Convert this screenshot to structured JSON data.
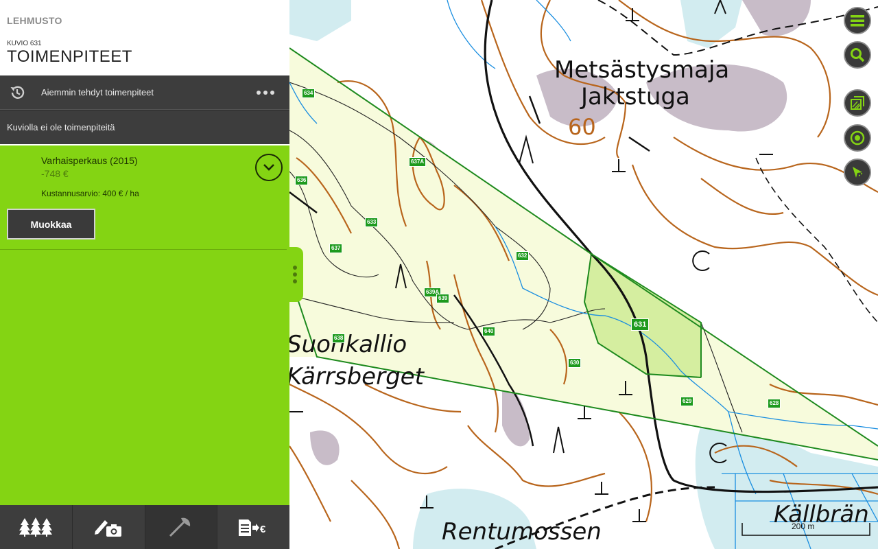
{
  "header": {
    "app_title": "LEHMUSTO",
    "subtitle": "KUVIO 631",
    "title": "TOIMENPITEET"
  },
  "history": {
    "label": "Aiemmin tehdyt toimenpiteet",
    "icon": "history-icon"
  },
  "empty_text": "Kuviolla ei ole toimenpiteitä",
  "operation": {
    "name": "Varhaisperkaus (2015)",
    "price": "-748 €",
    "cost_estimate": "Kustannusarvio: 400 € / ha",
    "edit_label": "Muokkaa"
  },
  "bottom_tabs": [
    {
      "icon": "trees-icon"
    },
    {
      "icon": "pencil-camera-icon"
    },
    {
      "icon": "axe-icon"
    },
    {
      "icon": "document-euro-icon"
    }
  ],
  "map": {
    "place_labels": [
      "Metsästysmaja",
      "Jaktstuga",
      "60",
      "Suonkallio",
      "Kärrsberget",
      "Rentumossen",
      "Källbrän"
    ],
    "stands": [
      "634",
      "637A",
      "636",
      "633",
      "637",
      "632",
      "639A",
      "639",
      "640",
      "638",
      "631",
      "630",
      "629",
      "628"
    ],
    "scale_label": "200 m",
    "buttons": [
      {
        "icon": "menu-icon"
      },
      {
        "icon": "search-icon"
      },
      {
        "icon": "layers-icon"
      },
      {
        "icon": "locate-icon"
      },
      {
        "icon": "navigate-icon"
      }
    ]
  },
  "colors": {
    "accent_green": "#84d413",
    "dark_panel": "#3d3d3d",
    "stand_label": "#1d9a1d"
  }
}
